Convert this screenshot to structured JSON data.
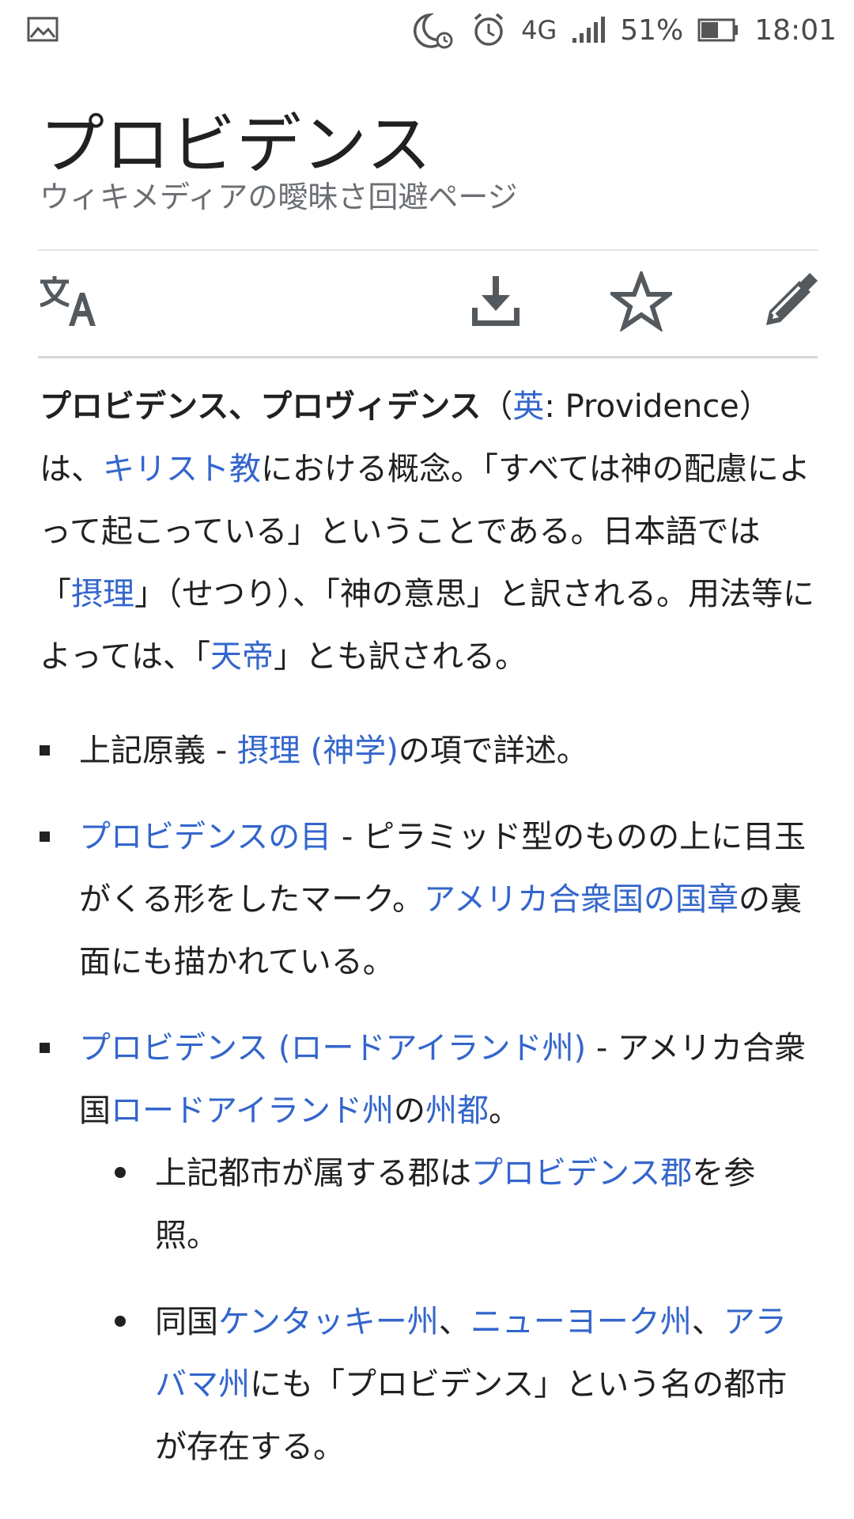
{
  "status_bar": {
    "network": "4G",
    "battery_percent": "51%",
    "time": "18:01"
  },
  "header": {
    "title": "プロビデンス",
    "description": "ウィキメディアの曖昧さ回避ページ"
  },
  "toolbar": {
    "icons": [
      "language-icon",
      "download-icon",
      "star-icon",
      "edit-icon"
    ]
  },
  "article": {
    "lead": {
      "bold": "プロビデンス、プロヴィデンス",
      "paren_open": "（",
      "lang_link": "英",
      "lang_colon": ": Providence）は、",
      "christianity_link": "キリスト教",
      "t1": "における概念。「すべては神の配慮によって起こっている」ということである。日本語では「",
      "setsuri_link": "摂理",
      "t2": "」（せつり）、「神の意思」と訳される。用法等によっては、「",
      "tentei_link": "天帝",
      "t3": "」とも訳される。"
    },
    "items": [
      {
        "pre": "上記原義 - ",
        "link": "摂理 (神学)",
        "post": "の項で詳述。"
      },
      {
        "link": "プロビデンスの目",
        "mid": " - ピラミッド型のものの上に目玉がくる形をしたマーク。",
        "link2": "アメリカ合衆国の国章",
        "post": "の裏面にも描かれている。"
      },
      {
        "link": "プロビデンス (ロードアイランド州)",
        "mid": " - アメリカ合衆国",
        "link2": "ロードアイランド州",
        "mid2": "の",
        "link3": "州都",
        "post": "。",
        "sub": [
          {
            "pre": "上記都市が属する郡は",
            "link": "プロビデンス郡",
            "post": "を参照。"
          },
          {
            "pre": "同国",
            "link": "ケンタッキー州",
            "sep1": "、",
            "link2": "ニューヨーク州",
            "sep2": "、",
            "link3": "アラバマ州",
            "post": "にも「プロビデンス」という名の都市が存在する。"
          }
        ]
      }
    ]
  }
}
